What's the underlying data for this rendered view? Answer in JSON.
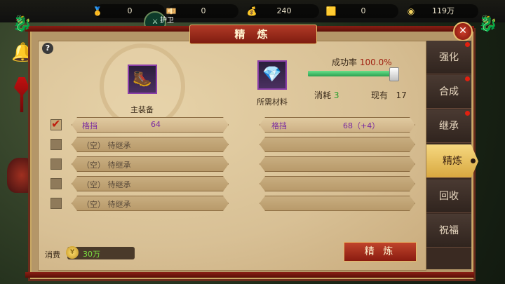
{
  "currencies": [
    {
      "icon": "gold-ingot-icon",
      "glyph": "🥇",
      "value": "0"
    },
    {
      "icon": "money-stack-icon",
      "glyph": "💴",
      "value": "0"
    },
    {
      "icon": "silver-ingot-icon",
      "glyph": "💰",
      "value": "240"
    },
    {
      "icon": "gold-ingot2-icon",
      "glyph": "🟨",
      "value": "0"
    },
    {
      "icon": "coin-icon",
      "glyph": "◉",
      "value": "119万"
    }
  ],
  "guard_label": "护卫",
  "dialog": {
    "title": "精 炼",
    "close": "✕",
    "help": "?"
  },
  "main_equip": {
    "label": "主装备",
    "icon": "boots-icon"
  },
  "material": {
    "label": "所需材料",
    "icon": "crystal-icon"
  },
  "success": {
    "label": "成功率",
    "value": "100.0%",
    "percent": 100
  },
  "consume": {
    "label": "消耗",
    "value": "3"
  },
  "owned": {
    "label": "现有",
    "value": "17"
  },
  "left_rows": [
    {
      "checked": true,
      "name": "格挡",
      "value": "64"
    },
    {
      "checked": false,
      "name": "（空）  待继承",
      "value": ""
    },
    {
      "checked": false,
      "name": "（空）  待继承",
      "value": ""
    },
    {
      "checked": false,
      "name": "（空）  待继承",
      "value": ""
    },
    {
      "checked": false,
      "name": "（空）  待继承",
      "value": ""
    }
  ],
  "right_rows": [
    {
      "name": "格挡",
      "value": "68（+4）"
    },
    {
      "name": "",
      "value": ""
    },
    {
      "name": "",
      "value": ""
    },
    {
      "name": "",
      "value": ""
    },
    {
      "name": "",
      "value": ""
    }
  ],
  "cost": {
    "label": "消费",
    "value": "30万"
  },
  "refine_button": "精 炼",
  "tabs": [
    {
      "label": "强化",
      "dot": true
    },
    {
      "label": "合成",
      "dot": true
    },
    {
      "label": "继承",
      "dot": true
    },
    {
      "label": "精炼",
      "selected": true
    },
    {
      "label": "回收",
      "dot": false
    },
    {
      "label": "祝福",
      "dot": false
    }
  ]
}
